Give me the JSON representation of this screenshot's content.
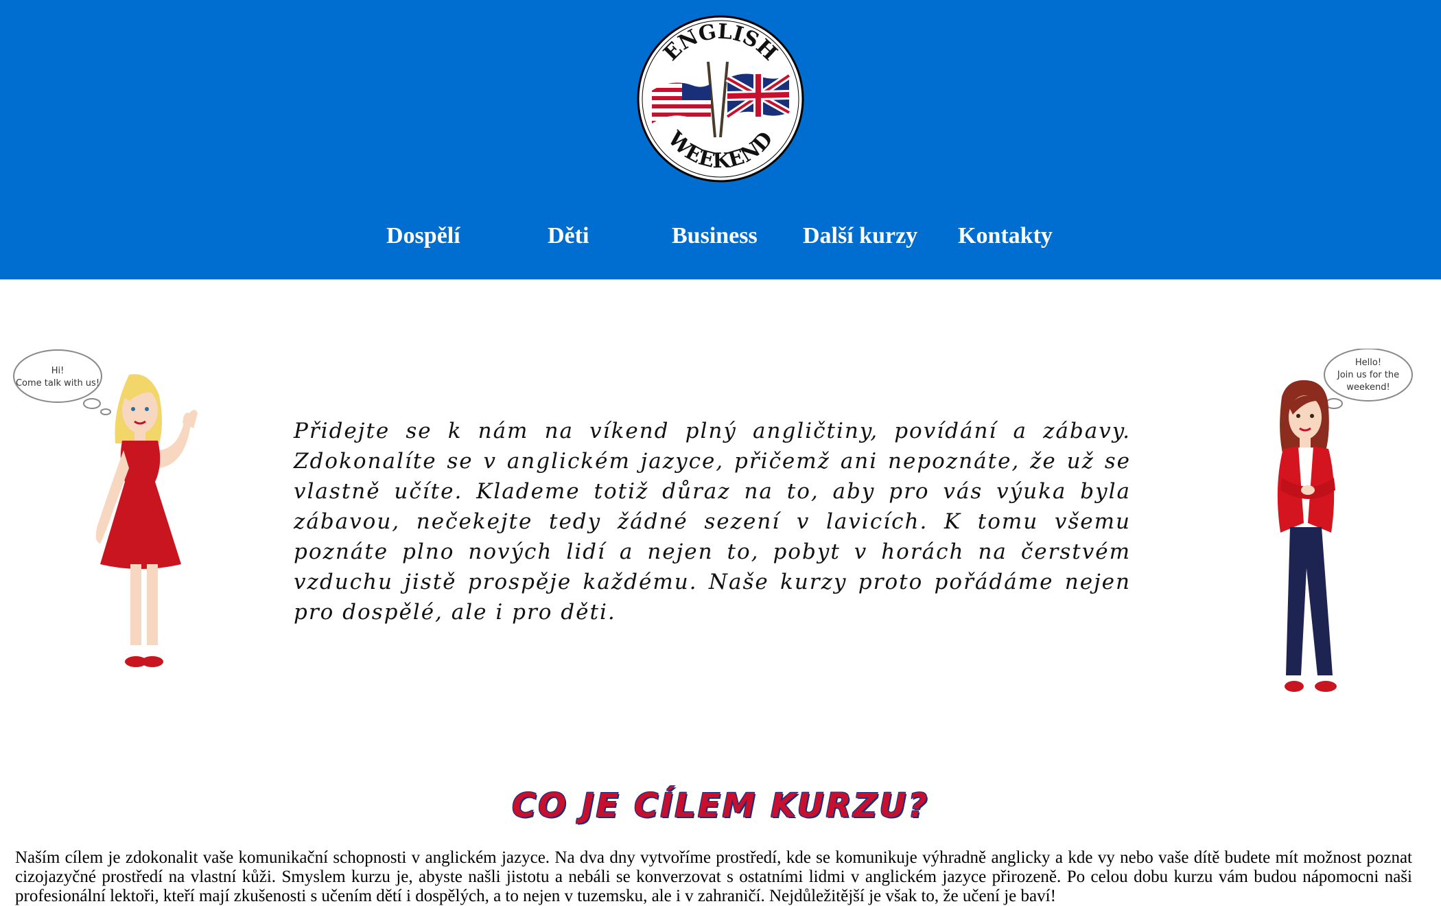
{
  "header": {
    "logo": {
      "top_text": "ENGLISH",
      "bottom_text": "WEEKEND",
      "icon": "crossed-us-uk-flags-icon"
    },
    "nav": [
      {
        "label": "Dospělí"
      },
      {
        "label": "Děti"
      },
      {
        "label": "Business"
      },
      {
        "label": "Další kurzy"
      },
      {
        "label": "Kontakty"
      }
    ],
    "background_color": "#006ed1"
  },
  "intro": {
    "left_bubble": [
      "Hi!",
      "Come talk with us!"
    ],
    "right_bubble": [
      "Hello!",
      "Join us for the",
      "weekend!"
    ],
    "text": "Přidejte se k nám na víkend plný angličtiny, povídání a zábavy. Zdokonalíte se v anglickém jazyce, přičemž ani nepoznáte, že už se vlastně učíte. Klademe totiž důraz na to, aby pro vás výuka byla zábavou, nečekejte tedy žádné sezení v lavicích. K tomu všemu poznáte plno nových lidí a nejen to, pobyt v horách na čerstvém vzduchu jistě prospěje každému. Naše kurzy proto pořádáme nejen pro dospělé, ale i pro děti."
  },
  "goal": {
    "heading": "CO JE CÍLEM KURZU?",
    "text": "Naším cílem je zdokonalit vaše komunikační schopnosti v anglickém jazyce. Na dva dny vytvoříme prostředí, kde se komunikuje výhradně anglicky a kde vy nebo vaše dítě budete mít možnost poznat cizojazyčné prostředí na vlastní kůži. Smyslem kurzu je, abyste našli jistotu a nebáli se konverzovat s ostatními lidmi v anglickém jazyce přirozeně. Po celou dobu kurzu vám budou nápomocni naši profesionální lektoři, kteří mají zkušenosti s učením dětí i dospělých, a to nejen v tuzemsku, ale i v zahraničí. Nejdůležitější je však to, že učení je baví!"
  },
  "colors": {
    "brand_blue": "#006ed1",
    "heading_red": "#c8102e",
    "heading_outline": "#1a2f7a"
  }
}
